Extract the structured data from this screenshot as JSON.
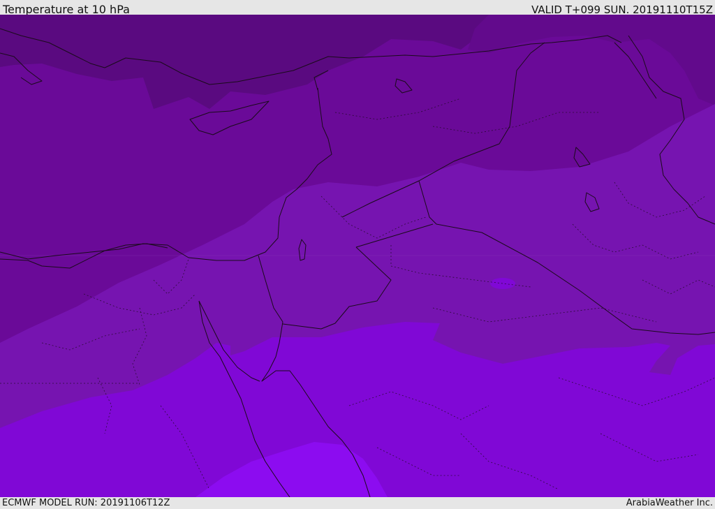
{
  "header": {
    "title": "Temperature at 10 hPa",
    "valid": "VALID T+099 SUN. 20191110T15Z"
  },
  "footer": {
    "model_run": "ECMWF MODEL RUN: 20191106T12Z",
    "credit": "ArabiaWeather Inc."
  },
  "map": {
    "field": "temperature",
    "colors": {
      "band_coldest": "#5a0a80",
      "band_cold": "#6a0a98",
      "band_mid": "#7614b0",
      "band_warm": "#8008d6",
      "band_warmest": "#8c0cf0",
      "coastline": "#1a0a1a"
    }
  }
}
